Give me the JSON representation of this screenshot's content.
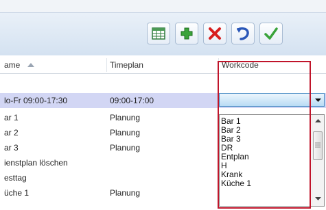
{
  "toolbar": {
    "buttons": [
      {
        "name": "grid-view",
        "icon": "table-icon"
      },
      {
        "name": "add",
        "icon": "plus-icon"
      },
      {
        "name": "delete",
        "icon": "x-icon"
      },
      {
        "name": "undo",
        "icon": "undo-icon"
      },
      {
        "name": "confirm",
        "icon": "checkmark-icon"
      }
    ]
  },
  "grid": {
    "columns": {
      "name": "ame",
      "timeplan": "Timeplan",
      "workcode": "Workcode"
    },
    "rows": [
      {
        "name": "lo-Fr 09:00-17:30",
        "timeplan": "09:00-17:00"
      },
      {
        "name": "ar 1",
        "timeplan": "Planung"
      },
      {
        "name": "ar 2",
        "timeplan": "Planung"
      },
      {
        "name": "ar 3",
        "timeplan": "Planung"
      },
      {
        "name": "ienstplan löschen",
        "timeplan": ""
      },
      {
        "name": "esttag",
        "timeplan": ""
      },
      {
        "name": "üche 1",
        "timeplan": "Planung"
      }
    ]
  },
  "workcode_dropdown": {
    "selected": "",
    "options": [
      "Bar 1",
      "Bar 2",
      "Bar 3",
      "DR",
      "Entplan",
      "H",
      "Krank",
      "Küche 1"
    ]
  },
  "colors": {
    "selected_row": "#d2d6f4",
    "highlight_frame": "#c0142a",
    "add_green": "#3aa33a",
    "delete_red": "#d81e1e",
    "undo_blue": "#2a57b8",
    "confirm_green": "#3aa33a"
  }
}
